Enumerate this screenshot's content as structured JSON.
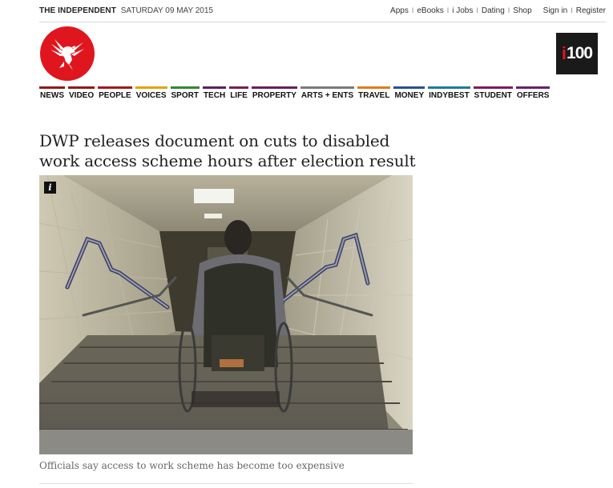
{
  "header": {
    "brand": "THE INDEPENDENT",
    "date": "SATURDAY 09 MAY 2015",
    "links": [
      "Apps",
      "eBooks",
      "i Jobs",
      "Dating",
      "Shop"
    ],
    "auth_links": [
      "Sign in",
      "Register"
    ],
    "separator": "I"
  },
  "logo": {
    "icon": "eagle-icon",
    "color": "#e0161e"
  },
  "i100": {
    "i": "i",
    "num": "100"
  },
  "nav": [
    {
      "label": "NEWS",
      "color": "#8e1b1b"
    },
    {
      "label": "VIDEO",
      "color": "#8e1b1b"
    },
    {
      "label": "PEOPLE",
      "color": "#a11a1a"
    },
    {
      "label": "VOICES",
      "color": "#e2a400"
    },
    {
      "label": "SPORT",
      "color": "#2f8a2f"
    },
    {
      "label": "TECH",
      "color": "#5f1f5f"
    },
    {
      "label": "LIFE",
      "color": "#7a1f4f"
    },
    {
      "label": "PROPERTY",
      "color": "#6a1f5f"
    },
    {
      "label": "ARTS + ENTS",
      "color": "#7a7a7a"
    },
    {
      "label": "TRAVEL",
      "color": "#e07b1a"
    },
    {
      "label": "MONEY",
      "color": "#2a4f8f"
    },
    {
      "label": "INDYBEST",
      "color": "#1f7a9a"
    },
    {
      "label": "STUDENT",
      "color": "#7a1f5f"
    },
    {
      "label": "OFFERS",
      "color": "#6a1f6f"
    }
  ],
  "article": {
    "headline": "DWP releases document on cuts to disabled work access scheme hours after election result",
    "caption": "Officials say access to work scheme has become too expensive",
    "info_icon": "i"
  }
}
